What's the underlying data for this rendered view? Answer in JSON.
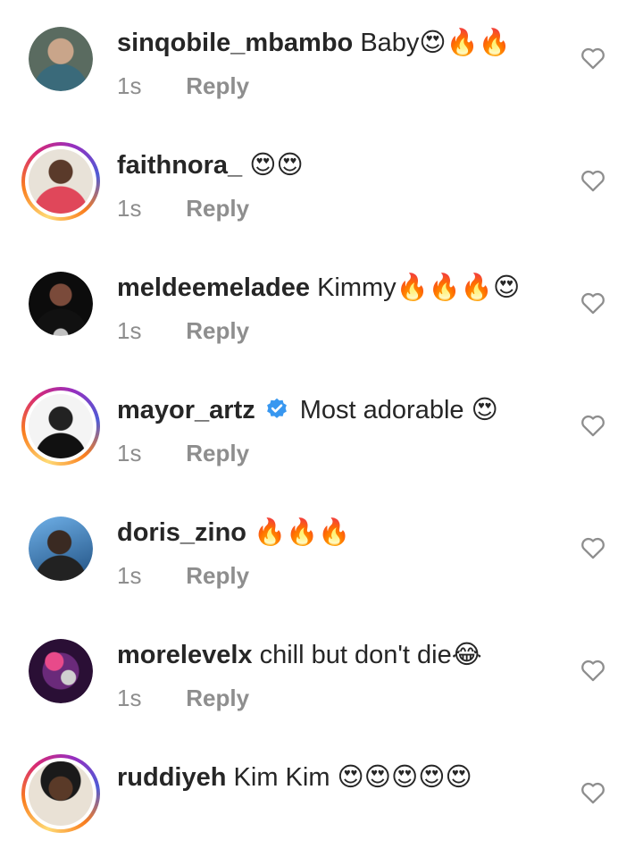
{
  "comments": [
    {
      "username": "sinqobile_mbambo",
      "text": "Baby😍🔥🔥",
      "time": "1s",
      "reply": "Reply",
      "story_ring": false,
      "verified": false,
      "avatar_color": "#4a5a52"
    },
    {
      "username": "faithnora_",
      "text": "😍😍",
      "time": "1s",
      "reply": "Reply",
      "story_ring": true,
      "verified": false,
      "avatar_color": "#c84a5a"
    },
    {
      "username": "meldeemeladee",
      "text": "Kimmy🔥🔥🔥😍",
      "time": "1s",
      "reply": "Reply",
      "story_ring": false,
      "verified": false,
      "avatar_color": "#1a1a1a"
    },
    {
      "username": "mayor_artz",
      "text": "Most adorable 😍",
      "time": "1s",
      "reply": "Reply",
      "story_ring": true,
      "verified": true,
      "avatar_color": "#f2f2f2"
    },
    {
      "username": "doris_zino",
      "text": "🔥🔥🔥",
      "time": "1s",
      "reply": "Reply",
      "story_ring": false,
      "verified": false,
      "avatar_color": "#2f6fa8"
    },
    {
      "username": "morelevelx",
      "text": "chill but don't die😂",
      "time": "1s",
      "reply": "Reply",
      "story_ring": false,
      "verified": false,
      "avatar_color": "#4a1f5a"
    },
    {
      "username": "ruddiyeh",
      "text": "Kim Kim 😍😍😍😍😍",
      "time": "",
      "reply": "",
      "story_ring": true,
      "verified": false,
      "avatar_color": "#6b4a35"
    }
  ],
  "colors": {
    "secondary_text": "#8e8e8e",
    "verified_blue": "#3897f0"
  }
}
